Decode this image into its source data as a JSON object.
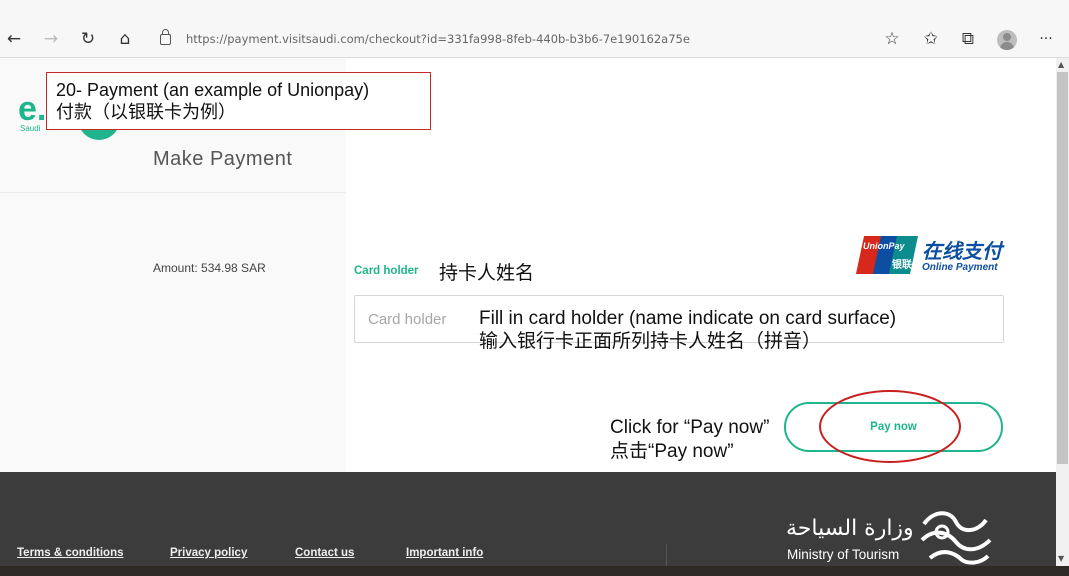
{
  "browser": {
    "url": "https://payment.visitsaudi.com/checkout?id=331fa998-8feb-440b-b3b6-7e190162a75e",
    "back_icon": "←",
    "forward_icon": "→",
    "refresh_icon": "↻",
    "home_icon": "⌂",
    "favorite_add_icon": "☆",
    "favorites_icon": "✩",
    "collections_icon": "⧉",
    "menu_icon": "···"
  },
  "logo": {
    "mark": "e.",
    "subtitle": "Saudi"
  },
  "annotation": {
    "title_en": "20- Payment (an example of Unionpay)",
    "title_zh": "付款（以银联卡为例）",
    "card_holder_zh": "持卡人姓名",
    "input_note_en": "Fill in card holder (name indicate on card surface)",
    "input_note_zh": "输入银行卡正面所列持卡人姓名（拼音）",
    "click_note_en": "Click for “Pay now”",
    "click_note_zh": "点击“Pay now”"
  },
  "payment": {
    "heading": "Make Payment",
    "amount": "Amount: 534.98 SAR",
    "card_holder_label": "Card holder",
    "card_holder_placeholder": "Card holder",
    "pay_button": "Pay now"
  },
  "unionpay": {
    "brand_en": "UnionPay",
    "brand_cn": "银联",
    "online_cn": "在线支付",
    "online_en": "Online Payment"
  },
  "footer": {
    "links": [
      "Terms & conditions",
      "Privacy policy",
      "Contact us",
      "Important info"
    ],
    "ministry_ar": "وزارة السياحة",
    "ministry_en": "Ministry of Tourism"
  },
  "colors": {
    "accent_green": "#1fb58c",
    "annotation_red": "#c62828",
    "footer_bg": "#3c3c3c",
    "unionpay_blue": "#0c4ea1"
  }
}
